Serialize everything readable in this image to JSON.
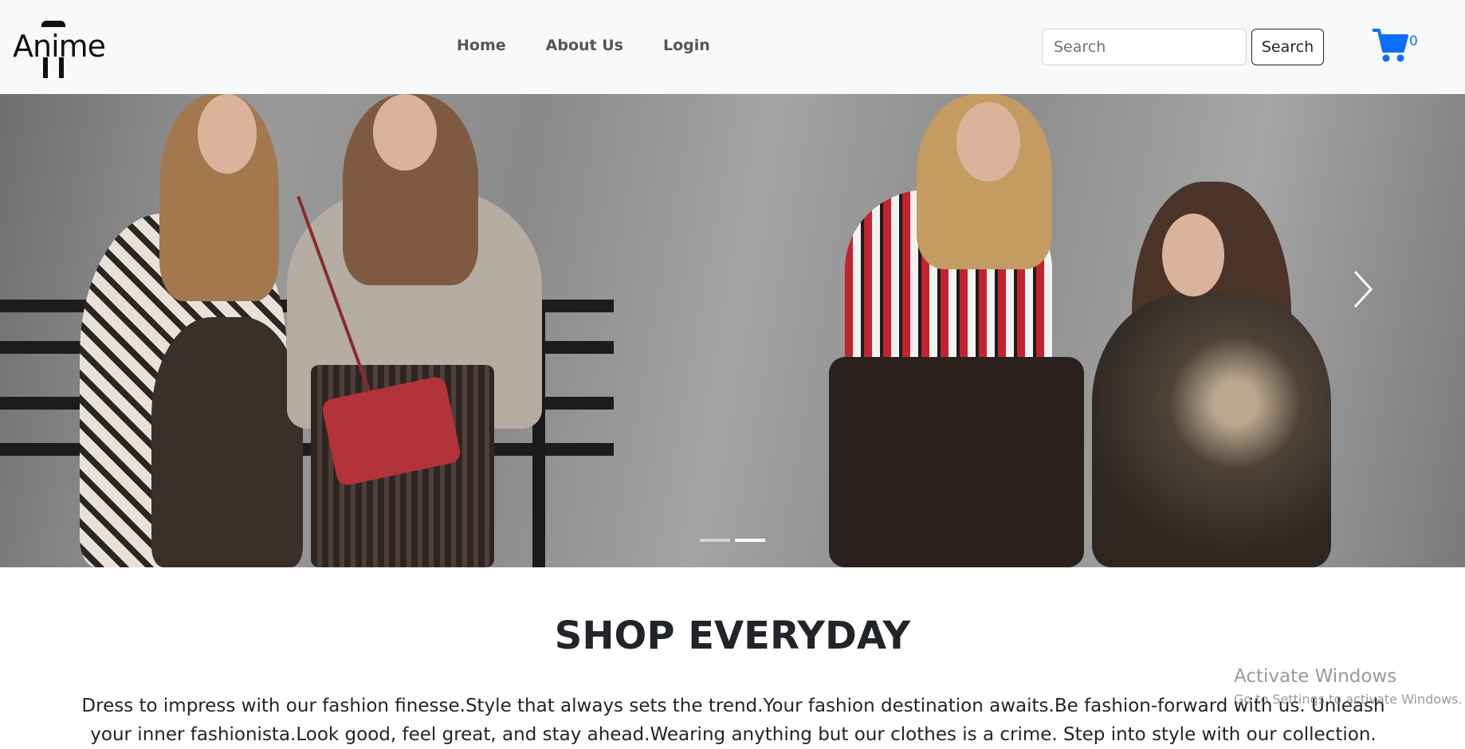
{
  "brand": {
    "logo_text": "Anime"
  },
  "nav": {
    "items": [
      {
        "label": "Home"
      },
      {
        "label": "About Us"
      },
      {
        "label": "Login"
      }
    ]
  },
  "search": {
    "placeholder": "Search",
    "value": "",
    "button_label": "Search"
  },
  "cart": {
    "icon": "cart-icon",
    "count": "0",
    "color": "#0d6efd"
  },
  "carousel": {
    "active_slide": 2,
    "slide_count": 2,
    "next_icon": "chevron-right-icon"
  },
  "main": {
    "title": "SHOP EVERYDAY",
    "intro": "Dress to impress with our fashion finesse.Style that always sets the trend.Your fashion destination awaits.Be fashion-forward with us. Unleash your inner fashionista.Look good, feel great, and stay ahead.Wearing anything but our clothes is a crime. Step into style with our collection."
  },
  "watermark": {
    "title": "Activate Windows",
    "subtitle": "Go to Settings to activate Windows."
  }
}
